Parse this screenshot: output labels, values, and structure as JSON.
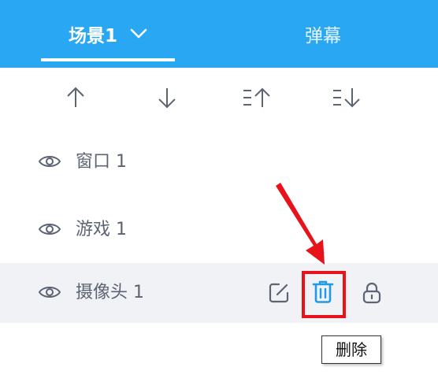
{
  "header": {
    "tabs": [
      {
        "label": "场景1",
        "active": true
      },
      {
        "label": "弹幕",
        "active": false
      }
    ]
  },
  "toolbar": {
    "buttons": [
      {
        "name": "move-up",
        "icon": "arrow-up-icon"
      },
      {
        "name": "move-down",
        "icon": "arrow-down-icon"
      },
      {
        "name": "move-top",
        "icon": "list-move-top-icon"
      },
      {
        "name": "move-bottom",
        "icon": "list-move-bottom-icon"
      }
    ]
  },
  "sources": [
    {
      "label": "窗口 1",
      "visible": true,
      "selected": false
    },
    {
      "label": "游戏 1",
      "visible": true,
      "selected": false
    },
    {
      "label": "摄像头 1",
      "visible": true,
      "selected": true
    }
  ],
  "row_actions": {
    "edit_icon": "edit-icon",
    "delete_icon": "trash-icon",
    "lock_icon": "lock-icon"
  },
  "tooltip": {
    "text": "删除"
  },
  "colors": {
    "header_bg": "#2aa7f2",
    "accent": "#1e9ae6",
    "highlight": "#e8121b",
    "selected_row_bg": "#f1f2f5"
  }
}
